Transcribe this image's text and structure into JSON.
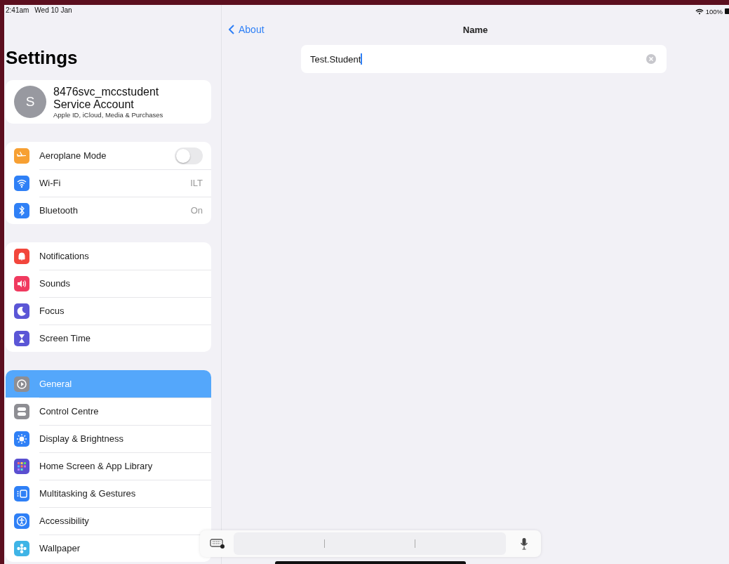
{
  "status_bar": {
    "time": "2:41am",
    "date": "Wed 10 Jan",
    "battery": "100%"
  },
  "sidebar": {
    "title": "Settings",
    "account": {
      "initial": "S",
      "name": "8476svc_mccstudent",
      "subtitle": "Service Account",
      "detail": "Apple ID, iCloud, Media & Purchases"
    },
    "groups": [
      [
        {
          "label": "Aeroplane Mode",
          "kind": "toggle",
          "on": false,
          "color": "#f7a033",
          "selected": false
        },
        {
          "label": "Wi-Fi",
          "kind": "value",
          "value": "ILT",
          "color": "#2f80f6",
          "selected": false
        },
        {
          "label": "Bluetooth",
          "kind": "value",
          "value": "On",
          "color": "#2f80f6",
          "selected": false
        }
      ],
      [
        {
          "label": "Notifications",
          "kind": "plain",
          "color": "#f2463c",
          "selected": false
        },
        {
          "label": "Sounds",
          "kind": "plain",
          "color": "#f03a5f",
          "selected": false
        },
        {
          "label": "Focus",
          "kind": "plain",
          "color": "#5b56d6",
          "selected": false
        },
        {
          "label": "Screen Time",
          "kind": "plain",
          "color": "#5b56d6",
          "selected": false
        }
      ],
      [
        {
          "label": "General",
          "kind": "plain",
          "color": "#8e8e93",
          "selected": true
        },
        {
          "label": "Control Centre",
          "kind": "plain",
          "color": "#8e8e93",
          "selected": false
        },
        {
          "label": "Display & Brightness",
          "kind": "plain",
          "color": "#2f80f6",
          "selected": false
        },
        {
          "label": "Home Screen & App Library",
          "kind": "plain",
          "color": "#5a4fd0",
          "selected": false
        },
        {
          "label": "Multitasking & Gestures",
          "kind": "plain",
          "color": "#2f80f6",
          "selected": false
        },
        {
          "label": "Accessibility",
          "kind": "plain",
          "color": "#2f80f6",
          "selected": false
        },
        {
          "label": "Wallpaper",
          "kind": "plain",
          "color": "#3fb4e6",
          "selected": false
        }
      ]
    ]
  },
  "detail": {
    "back": "About",
    "title": "Name",
    "field": {
      "value": "Test.Student"
    }
  }
}
